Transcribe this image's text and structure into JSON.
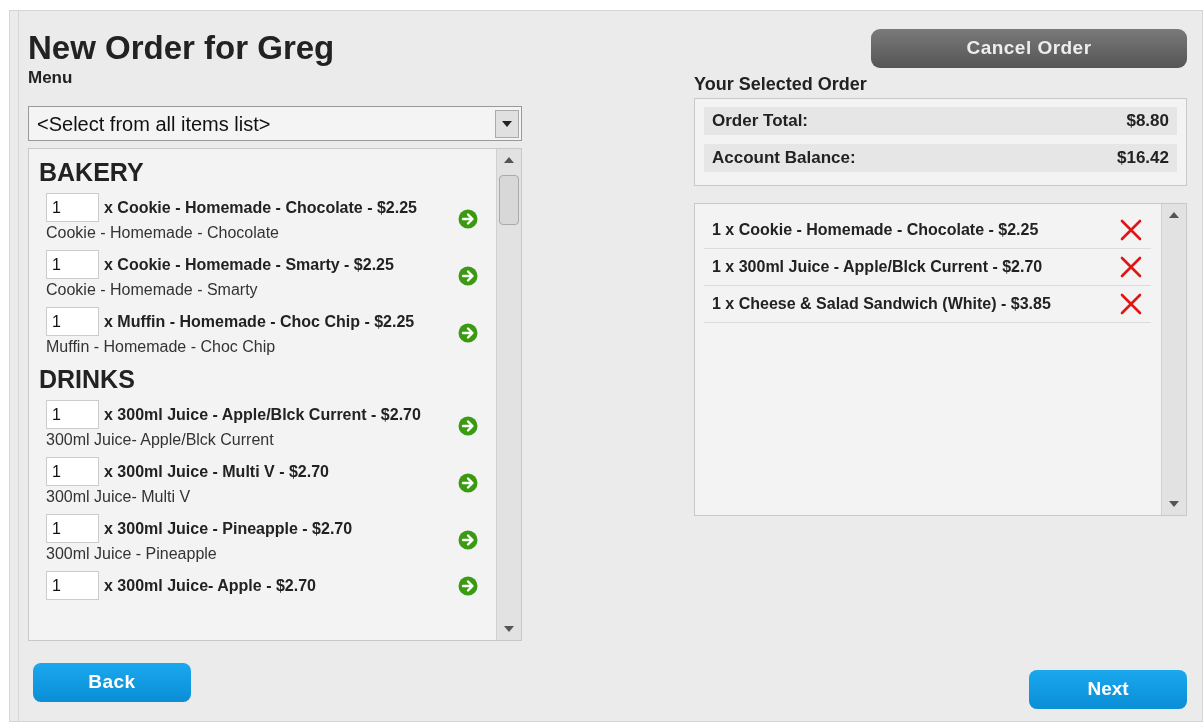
{
  "title": "New Order for Greg",
  "menu_label": "Menu",
  "item_select": {
    "value": "<Select from all items list>"
  },
  "categories": [
    {
      "name": "BAKERY",
      "items": [
        {
          "qty": "1",
          "title": "x Cookie - Homemade - Chocolate - $2.25",
          "description": "Cookie - Homemade - Chocolate"
        },
        {
          "qty": "1",
          "title": "x Cookie - Homemade - Smarty - $2.25",
          "description": "Cookie - Homemade - Smarty"
        },
        {
          "qty": "1",
          "title": "x Muffin - Homemade - Choc Chip - $2.25",
          "description": "Muffin - Homemade - Choc Chip"
        }
      ]
    },
    {
      "name": "DRINKS",
      "items": [
        {
          "qty": "1",
          "title": "x 300ml Juice - Apple/Blck Current - $2.70",
          "description": "300ml Juice- Apple/Blck Current"
        },
        {
          "qty": "1",
          "title": "x 300ml Juice - Multi V - $2.70",
          "description": "300ml Juice- Multi V"
        },
        {
          "qty": "1",
          "title": "x 300ml Juice - Pineapple - $2.70",
          "description": "300ml Juice - Pineapple"
        },
        {
          "qty": "1",
          "title": "x 300ml Juice- Apple - $2.70"
        }
      ]
    }
  ],
  "cancel_button": "Cancel Order",
  "order_heading": "Your Selected Order",
  "summary": [
    {
      "label": "Order Total:",
      "value": "$8.80"
    },
    {
      "label": "Account Balance:",
      "value": "$16.42"
    }
  ],
  "order_items": [
    "1 x Cookie - Homemade - Chocolate - $2.25",
    "1 x 300ml Juice - Apple/Blck Current - $2.70",
    "1 x Cheese & Salad Sandwich (White) - $3.85"
  ],
  "back_button": "Back",
  "next_button": "Next"
}
